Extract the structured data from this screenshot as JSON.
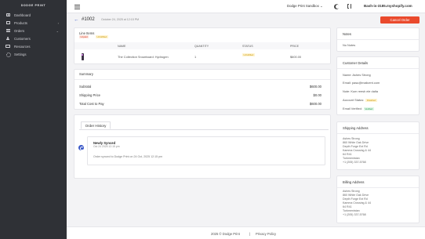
{
  "sidebar": {
    "logo": "DODGE PRINT",
    "items": [
      {
        "label": "Dashboard",
        "icon": "grid-icon"
      },
      {
        "label": "Products",
        "icon": "box-icon",
        "has_children": true
      },
      {
        "label": "Orders",
        "icon": "list-icon",
        "has_children": true
      },
      {
        "label": "Customers",
        "icon": "user-icon"
      },
      {
        "label": "Resources",
        "icon": "card-icon"
      },
      {
        "label": "Settings",
        "icon": "gear-icon"
      }
    ]
  },
  "topbar": {
    "store": "Dodge Print Sandbox ⌄",
    "shop_link": "Bash-is-3185.myshopify.com"
  },
  "order": {
    "id": "#1002",
    "date": "October 24, 2025 at 12:15 PM",
    "cancel_label": "Cancel Order"
  },
  "line_items": {
    "title": "Line Items",
    "badges": [
      "Unpaid",
      "Unfulfilled"
    ],
    "columns": [
      "NAME",
      "QUANTITY",
      "STATUS",
      "PRICE"
    ],
    "rows": [
      {
        "name": "The Collection Snowboard: Hydrogen",
        "quantity": "1",
        "status": "Unfulfilled",
        "price": "$600.00"
      }
    ]
  },
  "summary": {
    "title": "Summary",
    "subtotal_label": "Subtotal",
    "subtotal": "$600.00",
    "shipping_label": "Shipping Price",
    "shipping": "$0.00",
    "total_label": "Total Cost to Pay",
    "total": "$600.00"
  },
  "history": {
    "tab": "Order History",
    "event_title": "Newly Synced",
    "event_time": "Oct 24 2025 12:15 pm",
    "event_text": "Order synced to Dodge Print on 24 Oct, 2025 12:15 pm"
  },
  "notes": {
    "title": "Notes",
    "text": "No Notes"
  },
  "customer": {
    "title": "Customer Details",
    "name": "Name: Ashes Strong",
    "email": "Email: pasu@mailcent.com",
    "note": "Note: Kum reesh ele dalta",
    "status_label": "Account Status:",
    "status": "Disabled",
    "verified_label": "Email Verified:",
    "verified": "Verified"
  },
  "shipping": {
    "title": "Shipping Address",
    "lines": [
      "Ashes Strong",
      "860 White Oak Drive",
      "Depth Forge Ext Rd",
      "Kamma Crossing & 44",
      "64 R41",
      "Turkmenistan",
      "+1 (205) 337-5768"
    ]
  },
  "billing": {
    "title": "Billing Address",
    "lines": [
      "Ashes Strong",
      "860 White Oak Drive",
      "Depth Forge Ext Rd",
      "Kamma Crossing & 44",
      "64 R41",
      "Turkmenistan",
      "+1 (205) 337-5768"
    ]
  },
  "footer": {
    "copyright": "2025 © Dodge Print",
    "separator": "|",
    "privacy": "Privacy Policy"
  },
  "colors": {
    "accent": "#3856c7",
    "danger": "#ea4a2d",
    "sidebar": "#2f3136"
  }
}
